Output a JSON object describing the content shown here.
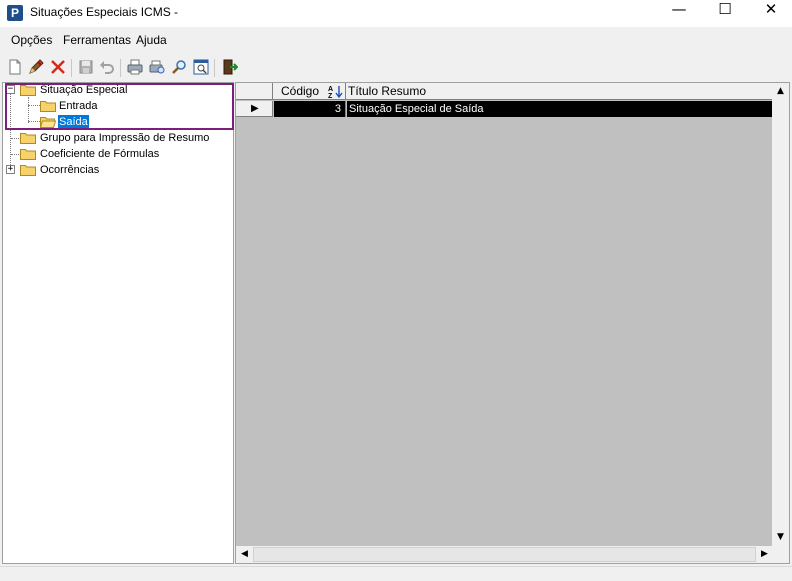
{
  "window": {
    "title": "Situações Especiais ICMS -",
    "app_icon_letter": "P",
    "minimize": "—",
    "maximize": "☐",
    "close": "✕"
  },
  "menu": {
    "items": [
      "Opções",
      "Ferramentas",
      "Ajuda"
    ]
  },
  "toolbar": {
    "icons": [
      "new-document-icon",
      "edit-pencil-icon",
      "delete-x-icon",
      "save-icon",
      "undo-icon",
      "print-icon",
      "print-preview-icon",
      "search-icon",
      "zoom-window-icon",
      "exit-door-icon"
    ]
  },
  "tree": {
    "nodes": [
      {
        "label": "Situação Especial",
        "expander": "−"
      },
      {
        "label": "Entrada"
      },
      {
        "label": "Saída",
        "selected": true
      },
      {
        "label": "Grupo para Impressão de Resumo"
      },
      {
        "label": "Coeficiente de Fórmulas"
      },
      {
        "label": "Ocorrências",
        "expander": "+"
      }
    ]
  },
  "grid": {
    "columns": [
      "Código",
      "Título Resumo"
    ],
    "sort_icon": "sort-az-icon",
    "rows": [
      {
        "indicator": "▶",
        "codigo": "3",
        "titulo": "Situação  Especial de Saída"
      }
    ],
    "scroll_up": "▲",
    "scroll_down": "▼",
    "scroll_left": "◀",
    "scroll_right": "▶"
  },
  "colors": {
    "selection": "#0078d7",
    "highlight_box": "#7a1f7a",
    "grid_background": "#c0c0c0",
    "folder": "#f5d36a"
  }
}
